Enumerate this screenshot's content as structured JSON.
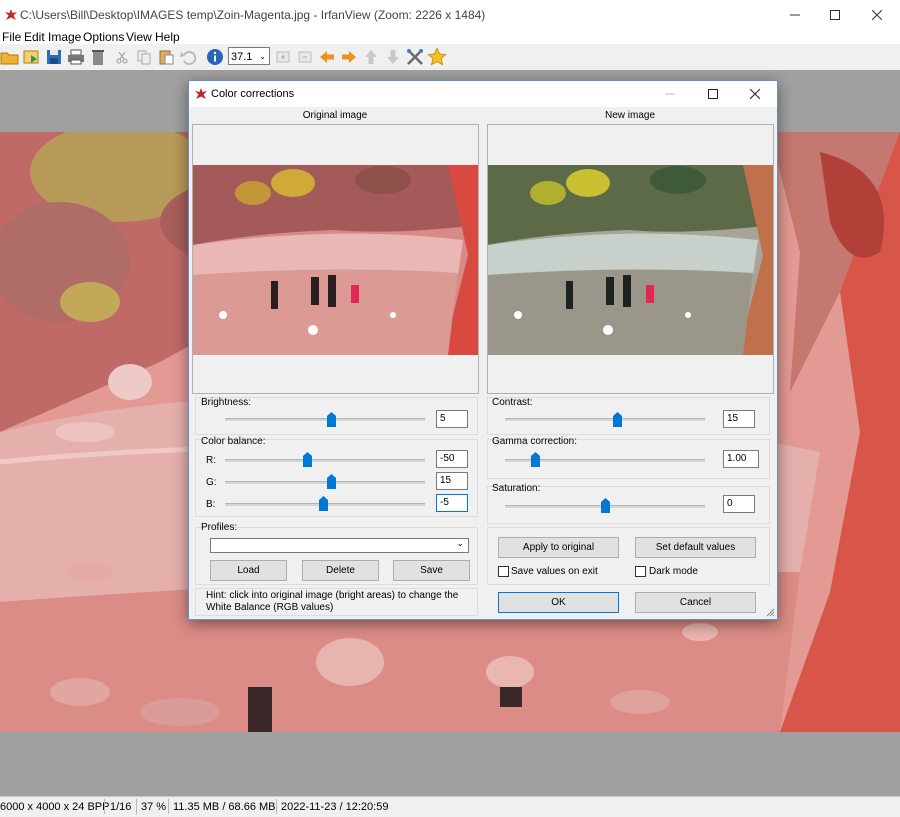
{
  "window": {
    "title": "C:\\Users\\Bill\\Desktop\\IMAGES temp\\Zoin-Magenta.jpg - IrfanView (Zoom: 2226 x 1484)"
  },
  "menu": {
    "items": [
      "File",
      "Edit",
      "Image",
      "Options",
      "View",
      "Help"
    ]
  },
  "toolbar": {
    "zoom_value": "37.1",
    "icons": [
      "open-folder-icon",
      "slideshow-icon",
      "save-icon",
      "print-icon",
      "delete-icon",
      "cut-icon",
      "copy-icon",
      "paste-icon",
      "undo-icon",
      "info-icon",
      "zoom-in-icon",
      "zoom-out-icon",
      "prev-icon",
      "next-icon",
      "up-icon",
      "down-icon",
      "settings-tools-icon",
      "favorite-star-icon"
    ]
  },
  "status": {
    "dimensions": "6000 x 4000 x 24 BPP",
    "index": "1/16",
    "zoom": "37 %",
    "memory": "11.35 MB / 68.66 MB",
    "datetime": "2022-11-23 / 12:20:59"
  },
  "dialog": {
    "title": "Color corrections",
    "original_label": "Original image",
    "new_label": "New image",
    "brightness": {
      "label": "Brightness:",
      "value": "5",
      "level": 0.53
    },
    "contrast": {
      "label": "Contrast:",
      "value": "15",
      "level": 0.56
    },
    "color_balance": {
      "label": "Color balance:",
      "r": {
        "label": "R:",
        "value": "-50",
        "level": 0.41
      },
      "g": {
        "label": "G:",
        "value": "15",
        "level": 0.53
      },
      "b": {
        "label": "B:",
        "value": "-5",
        "level": 0.49
      }
    },
    "gamma": {
      "label": "Gamma correction:",
      "value": "1.00",
      "level": 0.15
    },
    "saturation": {
      "label": "Saturation:",
      "value": "0",
      "level": 0.5
    },
    "profiles": {
      "label": "Profiles:",
      "selected": "",
      "load": "Load",
      "delete": "Delete",
      "save": "Save"
    },
    "hint": "Hint: click into original image (bright areas) to change the White Balance (RGB values)",
    "apply_original": "Apply to original",
    "set_default": "Set default values",
    "save_on_exit": "Save values on exit",
    "dark_mode": "Dark mode",
    "ok": "OK",
    "cancel": "Cancel"
  },
  "colors": {
    "accent": "#0078d7",
    "magenta_tint": "#ff6060"
  }
}
